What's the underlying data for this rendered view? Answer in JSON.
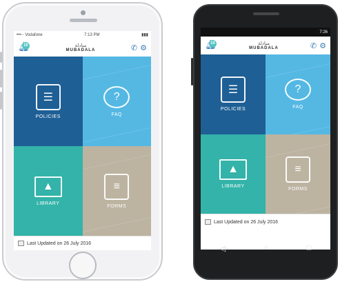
{
  "iphone": {
    "status": {
      "carrier": "•••◦◦ Vodafone",
      "time": "7:13 PM",
      "battery": "▮▮▮"
    },
    "header": {
      "badge": "10",
      "logo_ar": "مبادلة",
      "logo_en": "MUBADALA"
    },
    "tiles": {
      "policies": "POLICIES",
      "faq": "FAQ",
      "library": "LIBRARY",
      "forms": "FORMS"
    },
    "footer": "Last Updated on 26 July 2016"
  },
  "android": {
    "status": {
      "left": "",
      "time": "7:26"
    },
    "header": {
      "badge": "10",
      "logo_ar": "مبادلة",
      "logo_en": "MUBADALA"
    },
    "tiles": {
      "policies": "POLICIES",
      "faq": "FAQ",
      "library": "LIBRARY",
      "forms": "FORMS"
    },
    "footer": "Last Updated on 26 July 2016",
    "nav": {
      "back": "◁",
      "home": "○",
      "recents": "□"
    }
  },
  "icons": [
    "bell-icon",
    "phone-icon",
    "settings-icon",
    "policies-icon",
    "faq-icon",
    "library-icon",
    "forms-icon",
    "calendar-icon"
  ],
  "colors": {
    "policies": "#1e5f95",
    "faq": "#54b8e3",
    "library": "#33b3a9",
    "forms": "#bcb3a1"
  }
}
